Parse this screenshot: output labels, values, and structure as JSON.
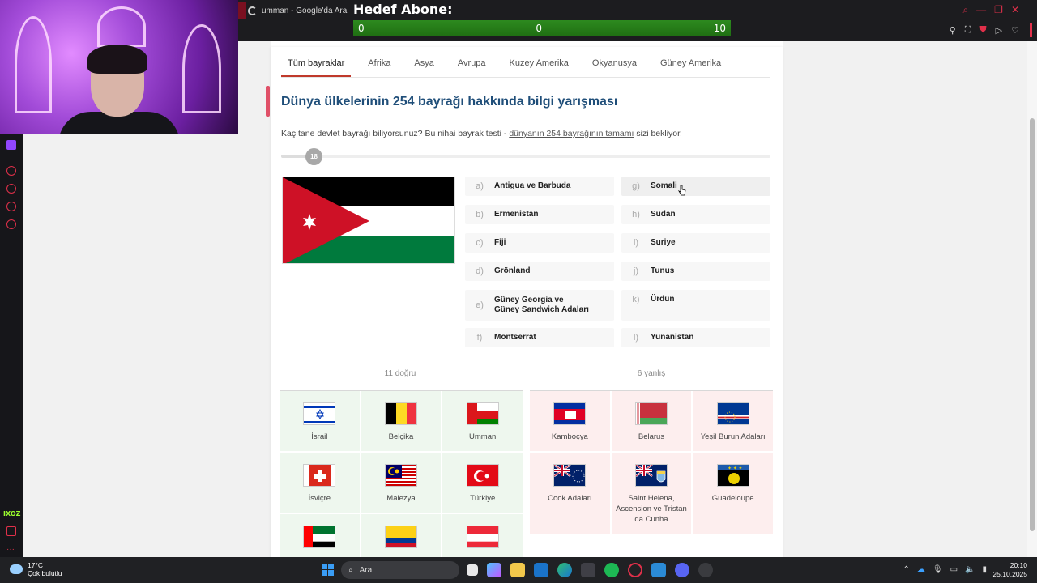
{
  "browser": {
    "tab_title": "umman - Google'da Ara"
  },
  "subscriber_goal": {
    "title": "Hedef Abone:",
    "left": "0",
    "center": "0",
    "right": "10"
  },
  "sidebar": {
    "tag": "IXOZ"
  },
  "tabs": [
    "Tüm bayraklar",
    "Afrika",
    "Asya",
    "Avrupa",
    "Kuzey Amerika",
    "Okyanusya",
    "Güney Amerika"
  ],
  "active_tab": "Tüm bayraklar",
  "quiz": {
    "title": "Dünya ülkelerinin 254 bayrağı hakkında bilgi yarışması",
    "intro_before": "Kaç tane devlet bayrağı biliyorsunuz? Bu nihai bayrak testi - ",
    "intro_link": "dünyanın 254 bayrağının tamamı",
    "intro_after": " sizi bekliyor.",
    "progress_label": "18",
    "progress_value": 18,
    "progress_total": 254
  },
  "options": [
    {
      "letter": "a)",
      "name": "Antigua ve Barbuda"
    },
    {
      "letter": "b)",
      "name": "Ermenistan"
    },
    {
      "letter": "c)",
      "name": "Fiji"
    },
    {
      "letter": "d)",
      "name": "Grönland"
    },
    {
      "letter": "e)",
      "name": "Güney Georgia ve Güney Sandwich Adaları"
    },
    {
      "letter": "f)",
      "name": "Montserrat"
    },
    {
      "letter": "g)",
      "name": "Somali"
    },
    {
      "letter": "h)",
      "name": "Sudan"
    },
    {
      "letter": "i)",
      "name": "Suriye"
    },
    {
      "letter": "j)",
      "name": "Tunus"
    },
    {
      "letter": "k)",
      "name": "Ürdün"
    },
    {
      "letter": "l)",
      "name": "Yunanistan"
    }
  ],
  "results": {
    "correct_label": "11 doğru",
    "wrong_label": "6 yanlış",
    "correct": [
      {
        "name": "İsrail",
        "icon": "israel-flag-icon"
      },
      {
        "name": "Belçika",
        "icon": "belgium-flag-icon"
      },
      {
        "name": "Umman",
        "icon": "oman-flag-icon"
      },
      {
        "name": "İsviçre",
        "icon": "switzerland-flag-icon"
      },
      {
        "name": "Malezya",
        "icon": "malaysia-flag-icon"
      },
      {
        "name": "Türkiye",
        "icon": "turkey-flag-icon"
      },
      {
        "name": "",
        "icon": "uae-flag-icon"
      },
      {
        "name": "",
        "icon": "colombia-flag-icon"
      },
      {
        "name": "",
        "icon": "austria-flag-icon"
      }
    ],
    "wrong": [
      {
        "name": "Kamboçya",
        "icon": "cambodia-flag-icon"
      },
      {
        "name": "Belarus",
        "icon": "belarus-flag-icon"
      },
      {
        "name": "Yeşil Burun Adaları",
        "icon": "cape-verde-flag-icon"
      },
      {
        "name": "Cook Adaları",
        "icon": "cook-islands-flag-icon"
      },
      {
        "name": "Saint Helena, Ascension ve Tristan da Cunha",
        "icon": "saint-helena-flag-icon"
      },
      {
        "name": "Guadeloupe",
        "icon": "guadeloupe-flag-icon"
      }
    ]
  },
  "taskbar": {
    "temperature": "17°C",
    "weather": "Çok bulutlu",
    "search_placeholder": "Ara",
    "time": "20:10",
    "date": "25.10.2025"
  },
  "colors": {
    "title": "#1f4e79",
    "accent": "#c0392b",
    "correct_bg": "#eef7ee",
    "wrong_bg": "#fdeeee"
  }
}
